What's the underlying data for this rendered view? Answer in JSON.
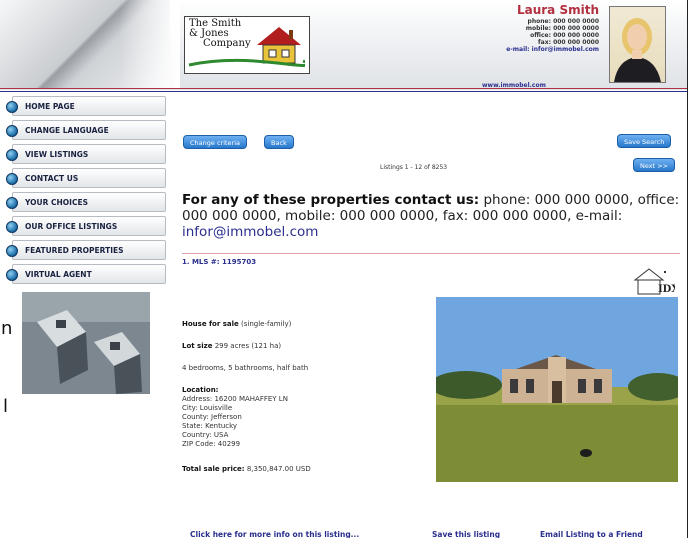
{
  "header": {
    "company_line1": "The Smith",
    "company_line2": "& Jones",
    "company_line3": "Company",
    "agent_name": "Laura Smith",
    "phone_label": "phone: 000 000 0000",
    "mobile_label": "mobile: 000 000 0000",
    "office_label": "office: 000 000 0000",
    "fax_label": "fax: 000 000 0000",
    "email_label": "e-mail: infor@immobel.com",
    "website": "www.immobel.com"
  },
  "nav": {
    "items": [
      {
        "label": "HOME PAGE"
      },
      {
        "label": "CHANGE LANGUAGE"
      },
      {
        "label": "VIEW LISTINGS"
      },
      {
        "label": "CONTACT US"
      },
      {
        "label": "YOUR CHOICES"
      },
      {
        "label": "OUR OFFICE LISTINGS"
      },
      {
        "label": "FEATURED PROPERTIES"
      },
      {
        "label": "VIRTUAL AGENT"
      }
    ]
  },
  "toolbar": {
    "change_criteria": "Change criteria",
    "back": "Back",
    "save_search": "Save Search",
    "next": "Next >>",
    "listings_count": "Listings 1 - 12 of 8253"
  },
  "contact_message": {
    "lead": "For any of these properties contact us:",
    "rest": " phone: 000 000 0000, office: 000 000 0000, mobile: 000 000 0000, fax: 000 000 0000, e-mail: ",
    "email": "infor@immobel.com"
  },
  "listing": {
    "mls": "1. MLS #: 1195703",
    "idx_logo_text": "IDX",
    "type_label": "House for sale",
    "type_value": "(single-family)",
    "lot_label": "Lot size",
    "lot_value": "299 acres (121 ha)",
    "rooms": "4 bedrooms, 5 bathrooms, half bath",
    "location_label": "Location:",
    "address": "Address: 16200 MAHAFFEY LN",
    "city": "City: Louisville",
    "county": "County: Jefferson",
    "state": "State: Kentucky",
    "country": "Country: USA",
    "zip": "ZIP Code: 40299",
    "price_label": "Total sale price:",
    "price_value": "8,350,847.00 USD"
  },
  "links": {
    "more_info": "Click here for more info on this listing...",
    "save_listing": "Save this listing",
    "email_friend": "Email Listing to a Friend"
  },
  "side_fragments": {
    "n": "n",
    "l": "l"
  },
  "colors": {
    "accent_blue": "#2778cc",
    "link_navy": "#2a2f8e",
    "name_red": "#b23040"
  }
}
